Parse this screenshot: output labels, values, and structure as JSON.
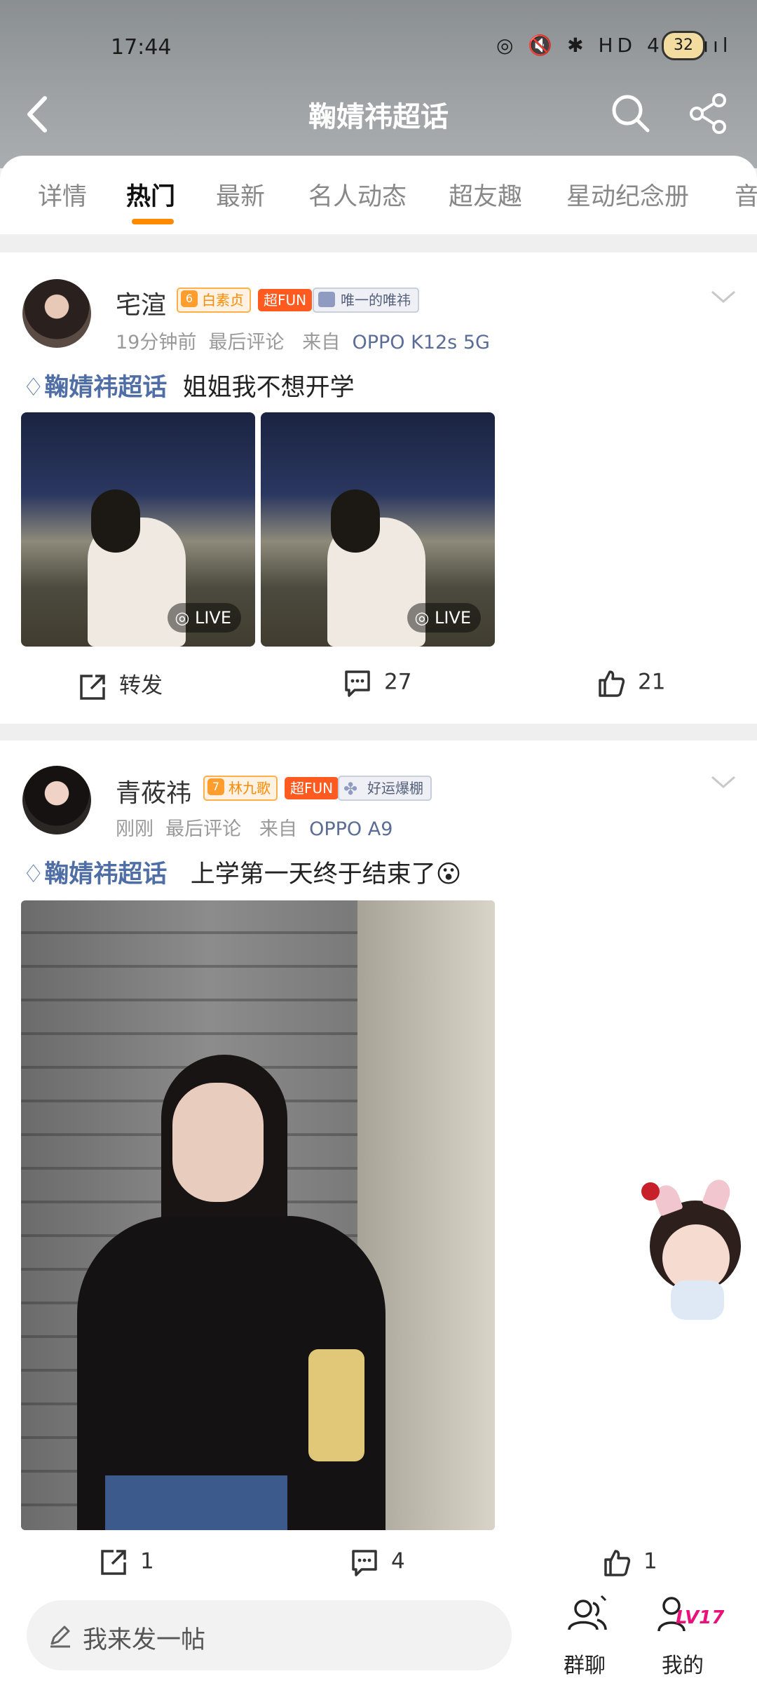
{
  "status": {
    "time": "17:44",
    "icons": "◎ 🔇 ✱ HD 4G ıııl",
    "battery": "32"
  },
  "header": {
    "title": "鞠婧祎超话"
  },
  "tabs": [
    "详情",
    "热门",
    "最新",
    "名人动态",
    "超友趣",
    "星动纪念册",
    "音"
  ],
  "posts": [
    {
      "username": "宅渲",
      "level": "6",
      "rank_badge": "白素贞",
      "fun_badge": "超FUN",
      "custom_badge": "唯一的唯祎",
      "time": "19分钟前",
      "comment_note": "最后评论",
      "from_label": "来自",
      "source": "OPPO K12s 5G",
      "topic": "鞠婧祎超话",
      "text": "姐姐我不想开学",
      "live_label": "LIVE",
      "repost_label": "转发",
      "comments": "27",
      "likes": "21"
    },
    {
      "username": "青莜祎",
      "level": "7",
      "rank_badge": "林九歌",
      "fun_badge": "超FUN",
      "custom_badge": "好运爆棚",
      "time": "刚刚",
      "comment_note": "最后评论",
      "from_label": "来自",
      "source": "OPPO A9",
      "topic": "鞠婧祎超话",
      "text": "上学第一天终于结束了😮",
      "reposts": "1",
      "comments": "4",
      "likes": "1"
    }
  ],
  "bottom": {
    "compose_placeholder": "我来发一帖",
    "group_label": "群聊",
    "me_label": "我的",
    "level_badge": "LV17"
  },
  "colors": {
    "accent": "#ff8a00",
    "topic": "#4f6ea5",
    "source": "#5b6c96",
    "fun_badge": "#ff5a1f"
  }
}
